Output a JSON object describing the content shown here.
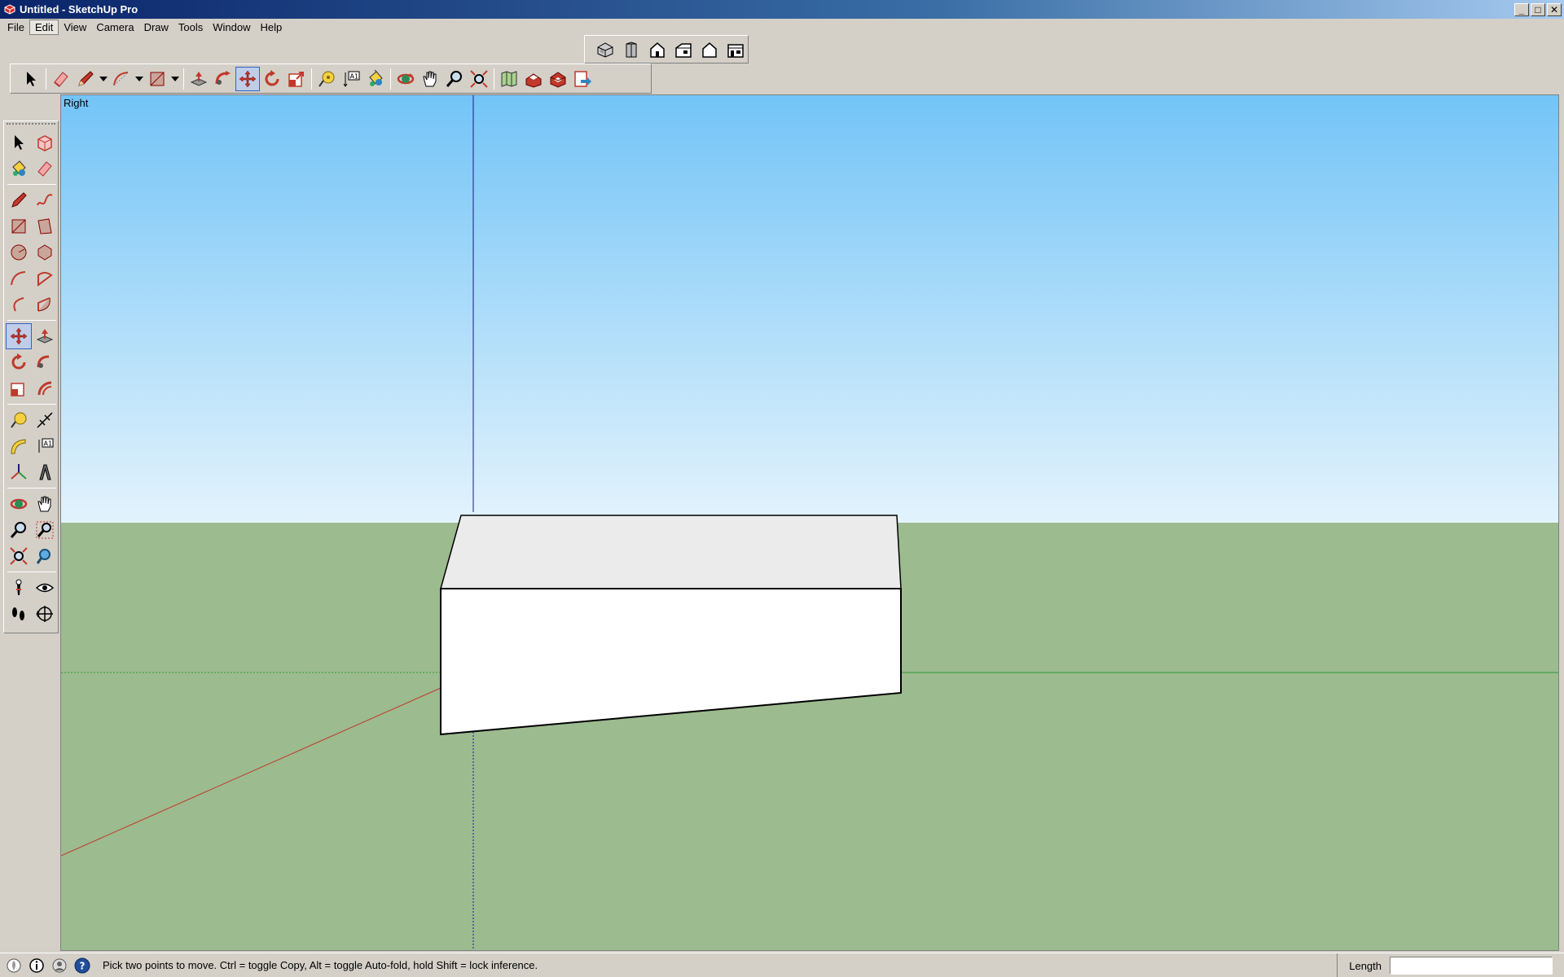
{
  "window": {
    "title": "Untitled - SketchUp Pro",
    "minimize_label": "_",
    "maximize_label": "□",
    "close_label": "✕"
  },
  "menubar": {
    "items": [
      "File",
      "Edit",
      "View",
      "Camera",
      "Draw",
      "Tools",
      "Window",
      "Help"
    ],
    "active": "Edit"
  },
  "views_toolbar": {
    "icons": [
      "iso-view-icon",
      "top-view-icon",
      "front-view-icon",
      "right-view-icon",
      "back-view-icon",
      "left-view-icon"
    ]
  },
  "large_toolbar": {
    "icons": [
      "select-icon",
      "eraser-icon",
      "pencil-icon",
      "arc-icon",
      "rectangle-icon",
      "push-pull-icon",
      "follow-me-icon",
      "move-icon",
      "rotate-icon",
      "scale-icon",
      "tape-measure-icon",
      "text-icon",
      "paint-bucket-icon",
      "orbit-icon",
      "pan-icon",
      "zoom-icon",
      "zoom-extents-icon",
      "map-icon",
      "warehouse-icon",
      "extension-warehouse-icon",
      "send-to-layout-icon"
    ],
    "active": "move-icon"
  },
  "left_toolbar": {
    "icons": [
      "select-icon",
      "make-component-icon",
      "paint-bucket-icon",
      "eraser-icon",
      "line-icon",
      "freehand-icon",
      "rectangle-icon",
      "rotated-rectangle-icon",
      "circle-icon",
      "polygon-icon",
      "arc-icon",
      "pie-icon",
      "two-point-arc-icon",
      "three-point-arc-icon",
      "move-icon",
      "push-pull-icon",
      "rotate-icon",
      "follow-me-icon",
      "scale-icon",
      "offset-icon",
      "tape-measure-icon",
      "dimension-icon",
      "protractor-icon",
      "text-icon",
      "axes-icon",
      "3d-text-icon",
      "orbit-icon",
      "pan-icon",
      "zoom-icon",
      "zoom-window-icon",
      "zoom-extents-icon",
      "previous-view-icon",
      "position-camera-icon",
      "look-around-icon",
      "walk-icon",
      "section-plane-icon"
    ],
    "active": "move-icon"
  },
  "viewport": {
    "scene_label": "Right",
    "colors": {
      "sky_top": "#73c4f7",
      "sky_bottom": "#e3f3fc",
      "ground": "#9cbb8f",
      "red_axis": "#c0392b",
      "green_axis": "#2e9b3a",
      "blue_axis": "#1a1a80"
    }
  },
  "statusbar": {
    "message": "Pick two points to move.  Ctrl = toggle Copy, Alt = toggle Auto-fold, hold Shift = lock inference.",
    "vcb_label": "Length",
    "vcb_value": ""
  }
}
